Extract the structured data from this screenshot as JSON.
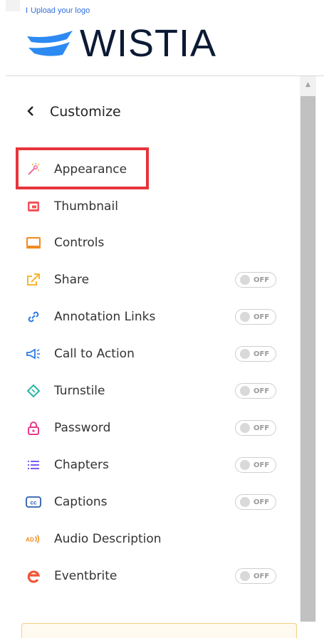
{
  "logo": {
    "upload_link": "Upload your logo",
    "brand_name": "WISTIA",
    "brand_color": "#0c1a35",
    "accent_color": "#2c8af2"
  },
  "panel": {
    "back_icon": "chevron-left-icon",
    "title": "Customize"
  },
  "items": [
    {
      "label": "Appearance",
      "icon": "magic-wand-icon",
      "icon_color": "#f06aa7",
      "toggle": null
    },
    {
      "label": "Thumbnail",
      "icon": "image-icon",
      "icon_color": "#f0555a",
      "toggle": null
    },
    {
      "label": "Controls",
      "icon": "monitor-icon",
      "icon_color": "#f28a1d",
      "toggle": null
    },
    {
      "label": "Share",
      "icon": "share-icon",
      "icon_color": "#f5b730",
      "toggle": "OFF"
    },
    {
      "label": "Annotation Links",
      "icon": "link-icon",
      "icon_color": "#2c7be5",
      "toggle": "OFF"
    },
    {
      "label": "Call to Action",
      "icon": "megaphone-icon",
      "icon_color": "#2c7be5",
      "toggle": "OFF"
    },
    {
      "label": "Turnstile",
      "icon": "ticket-icon",
      "icon_color": "#2bb5a0",
      "toggle": "OFF"
    },
    {
      "label": "Password",
      "icon": "lock-icon",
      "icon_color": "#ea3a8c",
      "toggle": "OFF"
    },
    {
      "label": "Chapters",
      "icon": "list-icon",
      "icon_color": "#7b5cf0",
      "toggle": "OFF"
    },
    {
      "label": "Captions",
      "icon": "cc-icon",
      "icon_color": "#2d5fae",
      "toggle": "OFF"
    },
    {
      "label": "Audio Description",
      "icon": "audio-description-icon",
      "icon_color": "#f28a1d",
      "toggle": null
    },
    {
      "label": "Eventbrite",
      "icon": "eventbrite-icon",
      "icon_color": "#f05537",
      "toggle": "OFF"
    }
  ],
  "highlight_color": "#e6343a"
}
